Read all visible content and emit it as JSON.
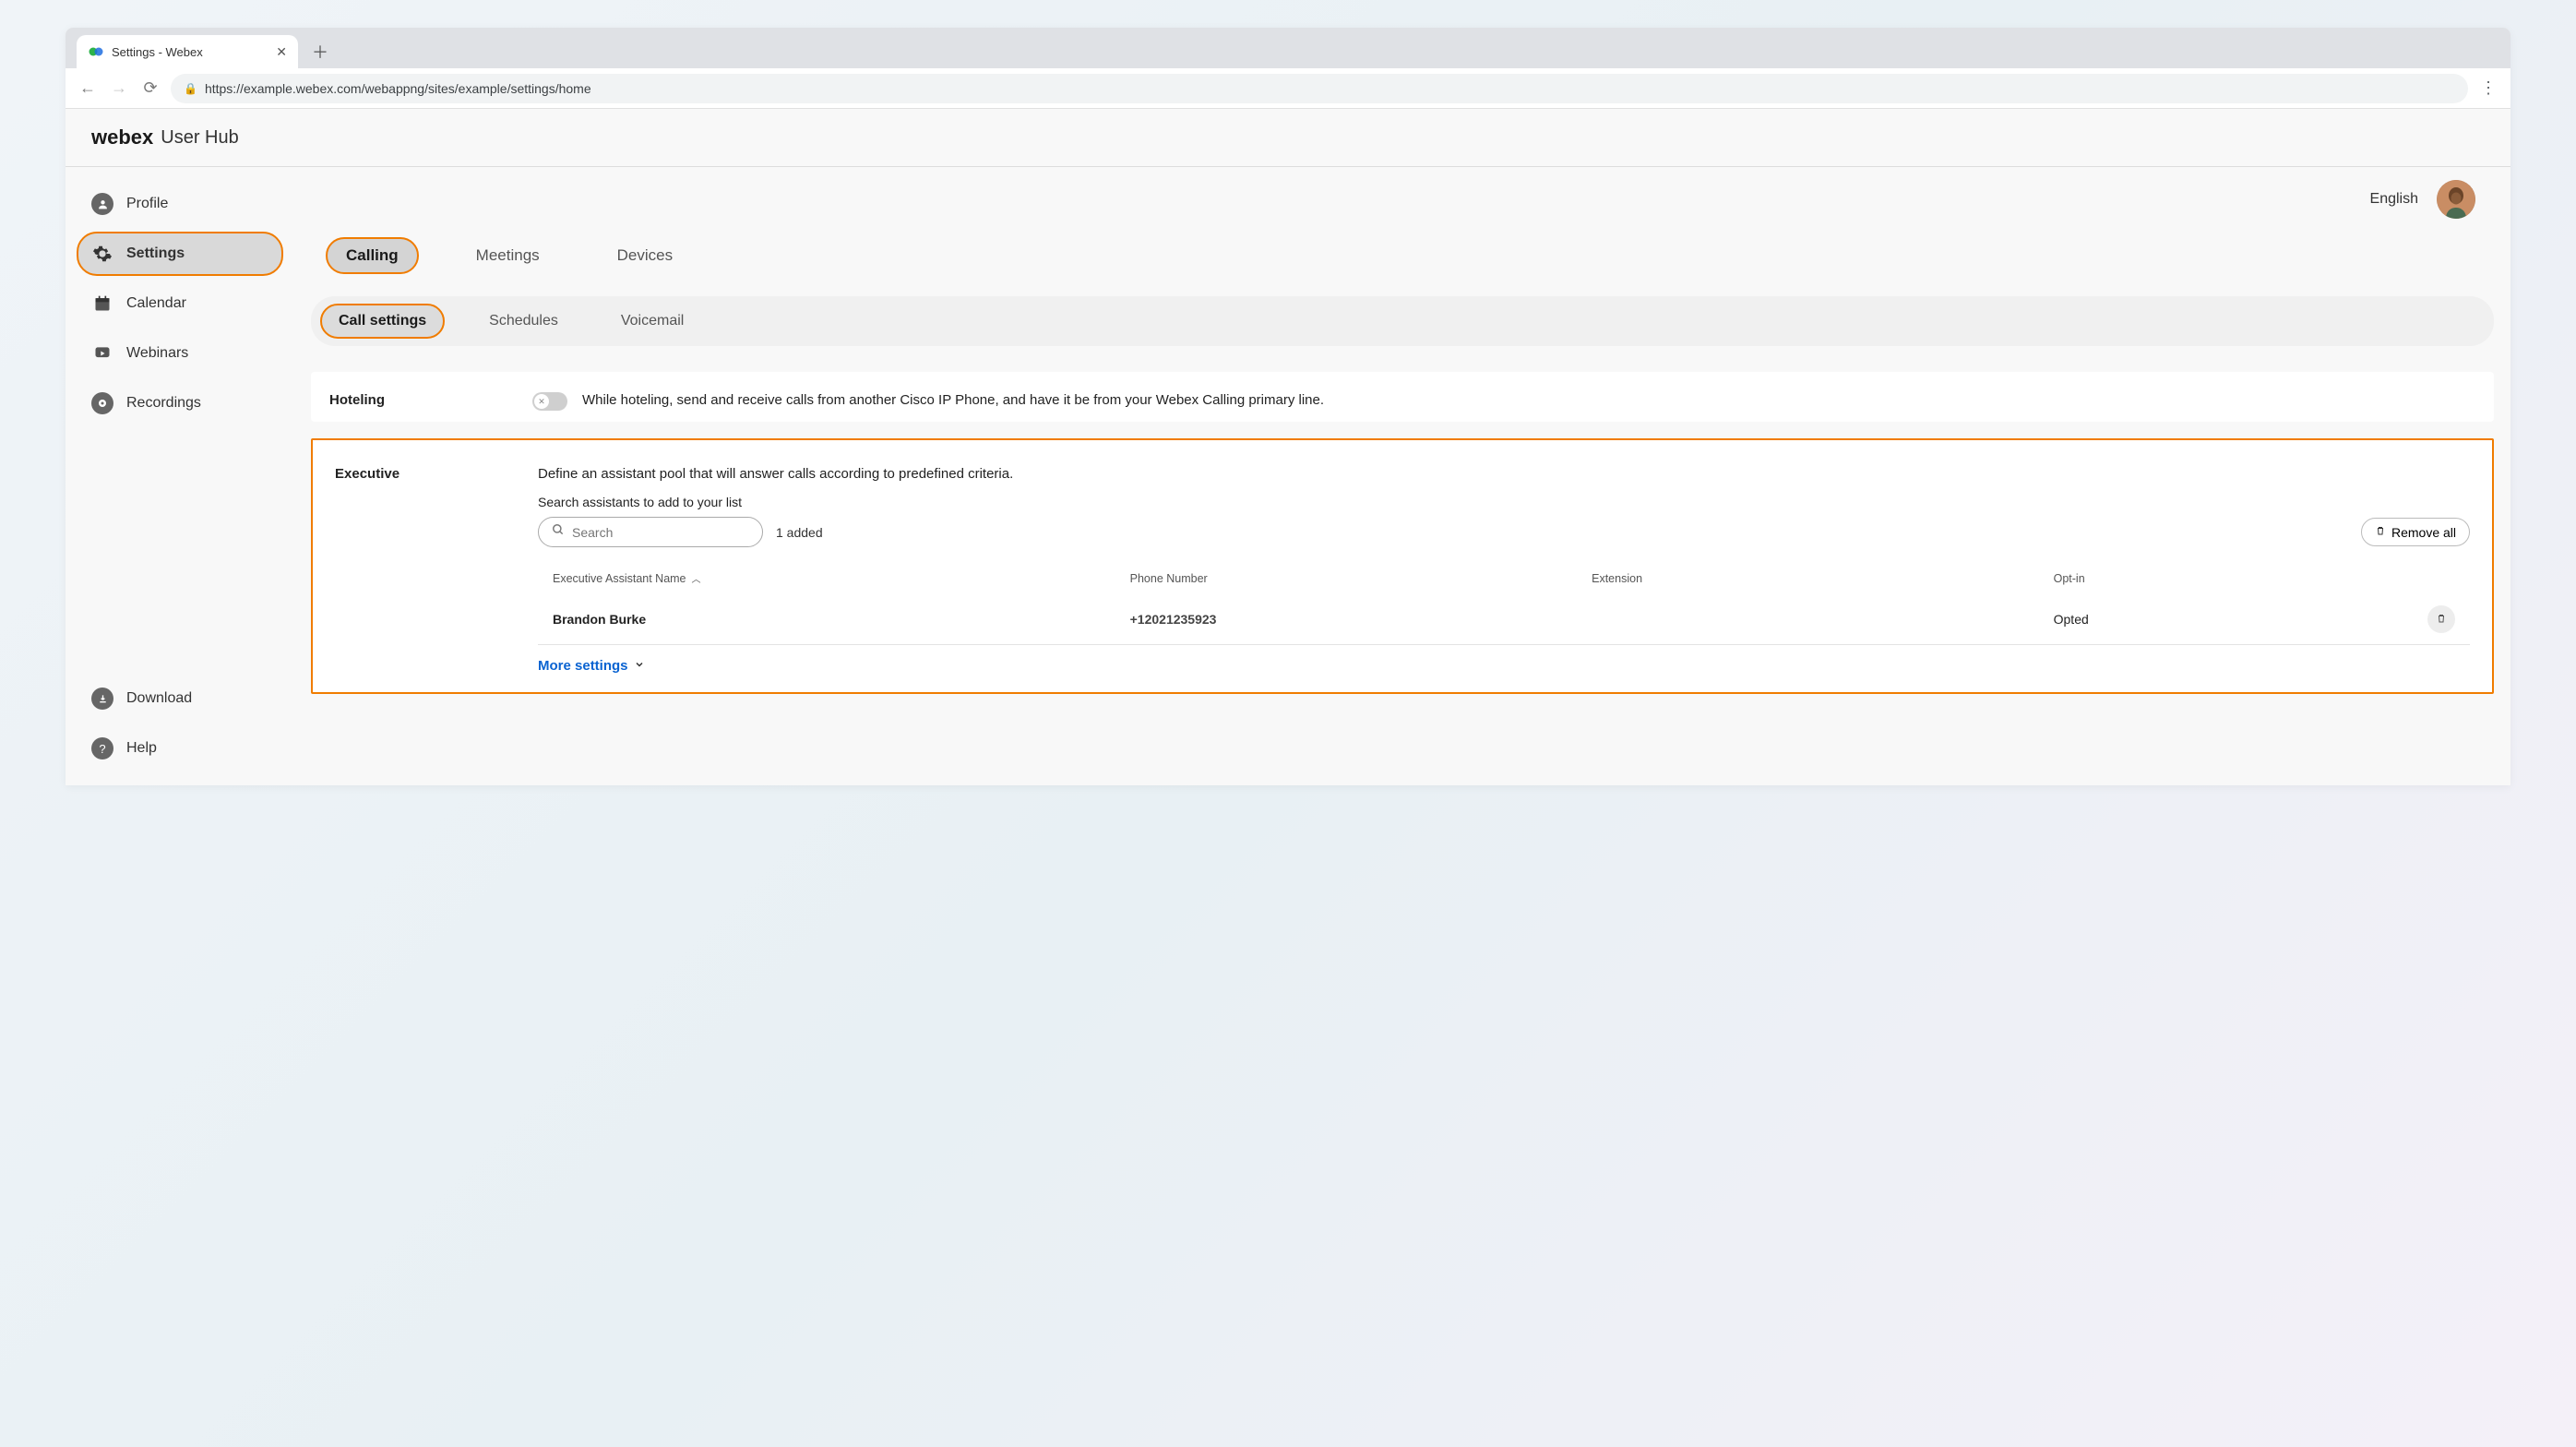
{
  "browser": {
    "tab_title": "Settings - Webex",
    "url": "https://example.webex.com/webappng/sites/example/settings/home"
  },
  "header": {
    "brand": "webex",
    "subtitle": "User Hub",
    "language": "English"
  },
  "sidebar": {
    "items": [
      {
        "label": "Profile"
      },
      {
        "label": "Settings"
      },
      {
        "label": "Calendar"
      },
      {
        "label": "Webinars"
      },
      {
        "label": "Recordings"
      }
    ],
    "bottom": [
      {
        "label": "Download"
      },
      {
        "label": "Help"
      }
    ]
  },
  "main_tabs": {
    "items": [
      {
        "label": "Calling"
      },
      {
        "label": "Meetings"
      },
      {
        "label": "Devices"
      }
    ]
  },
  "sub_tabs": {
    "items": [
      {
        "label": "Call settings"
      },
      {
        "label": "Schedules"
      },
      {
        "label": "Voicemail"
      }
    ]
  },
  "hoteling": {
    "title": "Hoteling",
    "description": "While hoteling, send and receive calls from another Cisco IP Phone, and have it be from your Webex Calling primary line."
  },
  "executive": {
    "title": "Executive",
    "description": "Define an assistant pool that will answer calls according to predefined criteria.",
    "search_label": "Search assistants to add to your list",
    "search_placeholder": "Search",
    "added_count": "1 added",
    "remove_all": "Remove all",
    "columns": {
      "name": "Executive Assistant Name",
      "phone": "Phone Number",
      "ext": "Extension",
      "optin": "Opt-in"
    },
    "rows": [
      {
        "name": "Brandon Burke",
        "phone": "+12021235923",
        "ext": "",
        "optin": "Opted"
      }
    ],
    "more": "More settings"
  }
}
